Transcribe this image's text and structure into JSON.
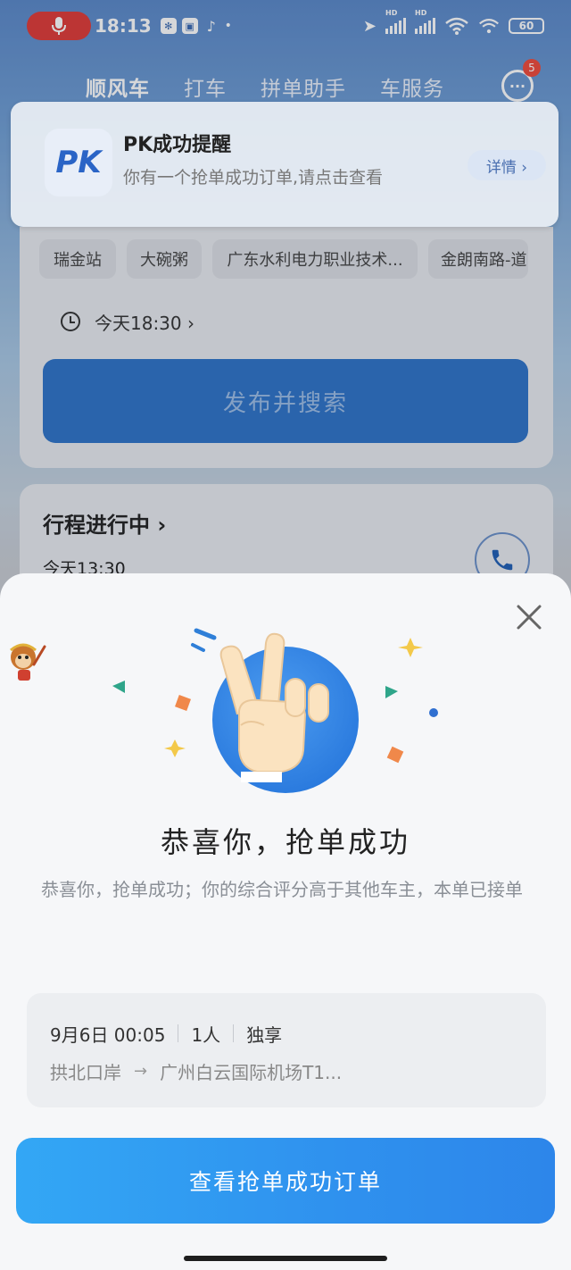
{
  "status_bar": {
    "time": "18:13",
    "battery": "60",
    "network_labels": [
      "HD",
      "HD"
    ]
  },
  "nav": {
    "tabs": [
      {
        "label": "顺风车",
        "active": true
      },
      {
        "label": "打车",
        "active": false
      },
      {
        "label": "拼单助手",
        "active": false
      },
      {
        "label": "车服务",
        "active": false
      }
    ],
    "message_badge": "5"
  },
  "notification": {
    "logo_text": "PK",
    "title": "PK成功提醒",
    "body": "你有一个抢单成功订单,请点击查看",
    "detail_label": "详情 ›"
  },
  "ride_form": {
    "places": [
      "瑞金站",
      "大碗粥",
      "广东水利电力职业技术...",
      "金朗南路-道"
    ],
    "time_label": "今天18:30 ›",
    "publish_label": "发布并搜索"
  },
  "trip": {
    "title": "行程进行中 ›",
    "time": "今天13:30"
  },
  "dialog": {
    "title": "恭喜你，抢单成功",
    "description": "恭喜你，抢单成功；你的综合评分高于其他车主，本单已接单",
    "order": {
      "date_time": "9月6日 00:05",
      "passengers": "1人",
      "type": "独享",
      "from": "拱北口岸",
      "to": "广州白云国际机场T1..."
    },
    "cta_label": "查看抢单成功订单"
  },
  "colors": {
    "accent": "#2f91ee",
    "mic_red": "#e03a36",
    "badge_red": "#f04a3a",
    "publish_blue": "#2e73c8"
  }
}
